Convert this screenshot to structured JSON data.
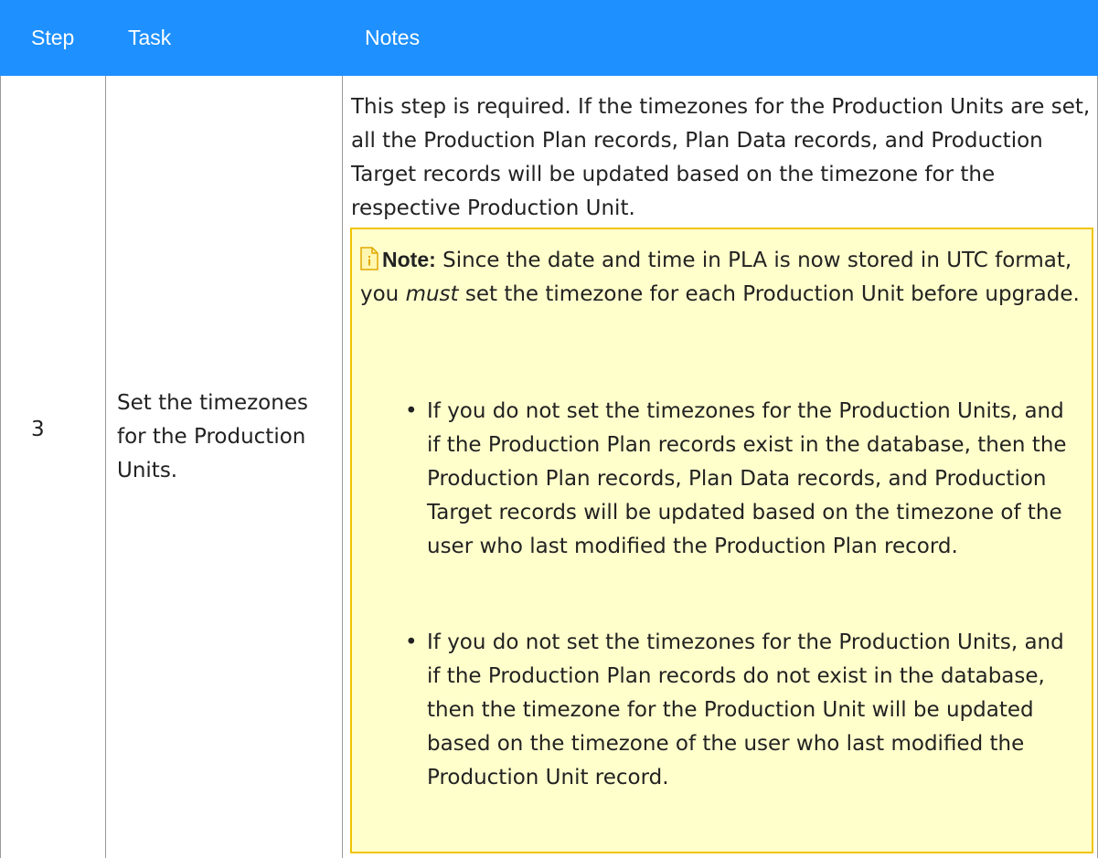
{
  "table": {
    "headers": {
      "step": "Step",
      "task": "Task",
      "notes": "Notes"
    },
    "row": {
      "step": "3",
      "task": "Set the timezones for the Production Units.",
      "notes_intro": "This step is required. If the timezones for the Production Units are set, all the Production Plan records, Plan Data records, and Production Target records will be updated based on the timezone for the respective Production Unit.",
      "note": {
        "label": "Note:",
        "icon": "note-icon",
        "text_before": " Since the date and time in PLA is now stored in UTC format, you ",
        "emphasis": "must",
        "text_after": " set the timezone for each Production Unit before upgrade.",
        "bullets": [
          "If you do not set the timezones for the Production Units, and if the Production Plan records exist in the database, then the Production Plan records, Plan Data records, and Production Target records will be updated based on the timezone of the user who last modified the Production Plan record.",
          "If you do not set the timezones for the Production Units, and if the Production Plan records do not exist in the database, then the timezone for the Production Unit will be updated based on the timezone of the user who last modified the Production Unit record."
        ]
      }
    }
  },
  "colors": {
    "header_bg": "#1e90ff",
    "header_text": "#ffffff",
    "note_bg": "#ffffcc",
    "note_border": "#f0c400",
    "grid_line": "#9a9a9a"
  }
}
